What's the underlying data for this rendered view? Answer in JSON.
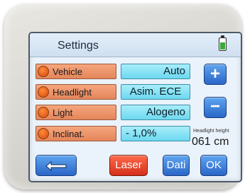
{
  "header": {
    "title": "Settings",
    "battery_icon": "battery-icon",
    "battery_level": 0.6
  },
  "rows": [
    {
      "label": "Vehicle",
      "value": "Auto"
    },
    {
      "label": "Headlight",
      "value": "Asim. ECE"
    },
    {
      "label": "Light",
      "value": "Alogeno"
    },
    {
      "label": "Inclinat.",
      "value": "- 1,0%"
    }
  ],
  "headlight_height": {
    "label": "Headlight height",
    "value": "061 cm"
  },
  "buttons": {
    "plus": "+",
    "minus": "−",
    "back_icon": "return-arrow-icon",
    "laser": "Laser",
    "dati": "Dati",
    "ok": "OK"
  },
  "colors": {
    "label_bg": "#f5a67e",
    "value_bg": "#a9eefa",
    "button_blue": "#2a66c8",
    "laser_red": "#d4301a"
  }
}
